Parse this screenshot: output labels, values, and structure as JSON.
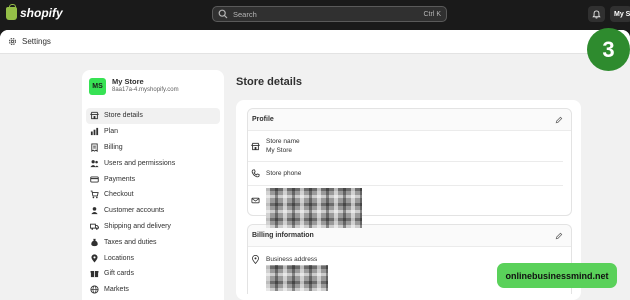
{
  "topbar": {
    "brand": "shopify",
    "search_placeholder": "Search",
    "search_shortcut": "Ctrl K",
    "user_label": "My Sto"
  },
  "window": {
    "title": "Settings"
  },
  "step_badge": "3",
  "sidebar": {
    "avatar_initials": "MS",
    "store_name": "My Store",
    "store_domain": "8aa17a-4.myshopify.com",
    "items": [
      {
        "label": "Store details",
        "icon": "store-icon",
        "active": true
      },
      {
        "label": "Plan",
        "icon": "plan-icon"
      },
      {
        "label": "Billing",
        "icon": "billing-icon"
      },
      {
        "label": "Users and permissions",
        "icon": "users-icon"
      },
      {
        "label": "Payments",
        "icon": "payments-icon"
      },
      {
        "label": "Checkout",
        "icon": "cart-icon"
      },
      {
        "label": "Customer accounts",
        "icon": "customer-icon"
      },
      {
        "label": "Shipping and delivery",
        "icon": "truck-icon"
      },
      {
        "label": "Taxes and duties",
        "icon": "tax-icon"
      },
      {
        "label": "Locations",
        "icon": "location-icon"
      },
      {
        "label": "Gift cards",
        "icon": "gift-icon"
      },
      {
        "label": "Markets",
        "icon": "globe-icon"
      }
    ]
  },
  "main": {
    "title": "Store details",
    "profile": {
      "title": "Profile",
      "store_name_label": "Store name",
      "store_name_value": "My Store",
      "store_phone_label": "Store phone"
    },
    "billing": {
      "title": "Billing information",
      "address_label": "Business address"
    }
  },
  "watermark": "onlinebusinessmind.net",
  "colors": {
    "topbar": "#1a1a1a",
    "avatar": "#37e254",
    "badge": "#2e8b2e",
    "watermark": "#5ad15a",
    "brand": "#95bf47"
  }
}
